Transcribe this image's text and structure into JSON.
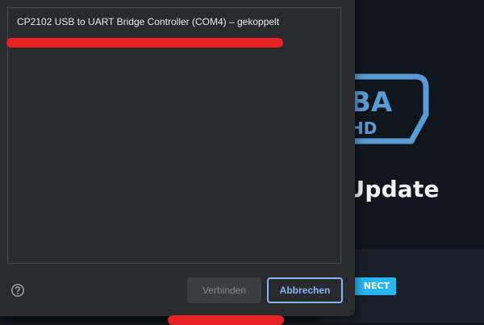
{
  "background_app": {
    "title_fragment": "D Update",
    "connect_button_label": "NECT",
    "logo_fragment": "BA",
    "logo_sub_fragment": "HD"
  },
  "dialog": {
    "devices": [
      {
        "label": "CP2102 USB to UART Bridge Controller (COM4) – gekoppelt"
      }
    ],
    "help_icon": "question-circle-icon",
    "connect_label": "Verbinden",
    "cancel_label": "Abbrechen"
  },
  "colors": {
    "dialog_bg": "#292a2d",
    "accent": "#8ab4f8",
    "app_bg": "#0f161d",
    "connect_blue": "#29b6f0",
    "logo_blue": "#5b9bd5",
    "redaction": "#e82323"
  }
}
